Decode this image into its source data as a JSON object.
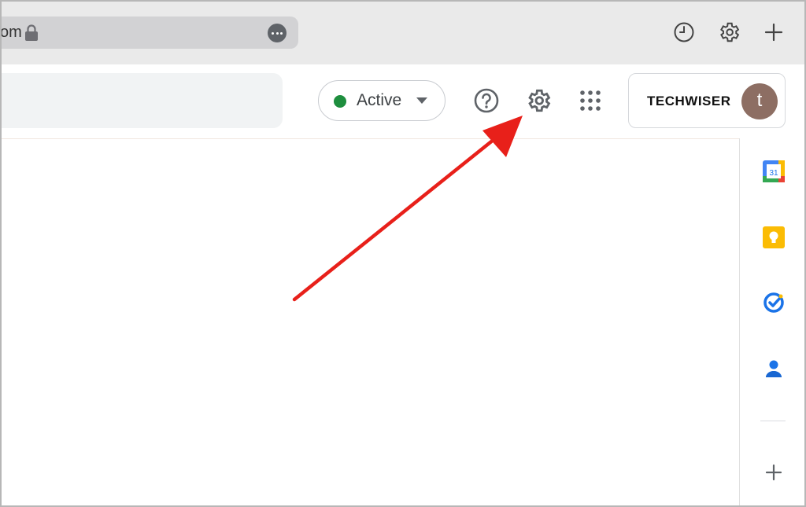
{
  "browser": {
    "url_fragment": "om",
    "toolbar_icons": [
      "history-icon",
      "gear-icon",
      "plus-icon"
    ]
  },
  "header": {
    "status": {
      "label": "Active",
      "color": "#1e8e3e"
    },
    "icons": [
      "help-icon",
      "gear-icon",
      "apps-grid-icon"
    ],
    "brand": "TECHWISER",
    "avatar_letter": "t",
    "avatar_color": "#8d6e63"
  },
  "side_panel": {
    "calendar_day": "31",
    "apps": [
      "google-calendar-icon",
      "google-keep-icon",
      "google-tasks-icon",
      "google-contacts-icon"
    ],
    "add_icon": "plus-icon"
  },
  "annotation": {
    "type": "arrow",
    "color": "#e8201a",
    "target": "settings-gear"
  }
}
